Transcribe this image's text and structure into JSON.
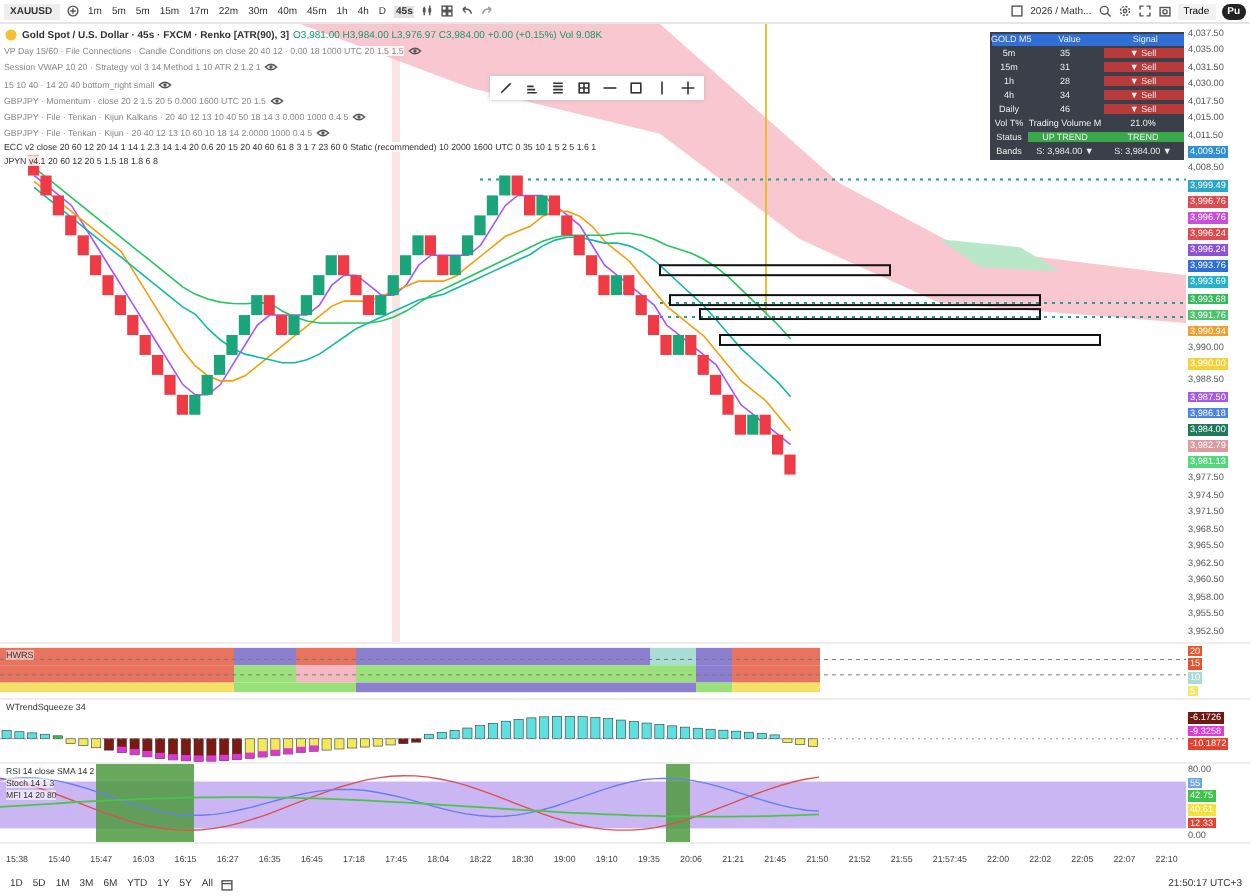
{
  "toolbar": {
    "symbol": "XAUUSD",
    "intervals": [
      {
        "label": "1m",
        "selected": false
      },
      {
        "label": "5m",
        "selected": false
      },
      {
        "label": "5m",
        "selected": false
      },
      {
        "label": "15m",
        "selected": false
      },
      {
        "label": "17m",
        "selected": false
      },
      {
        "label": "22m",
        "selected": false
      },
      {
        "label": "30m",
        "selected": false
      },
      {
        "label": "40m",
        "selected": false
      },
      {
        "label": "45m",
        "selected": false
      },
      {
        "label": "1h",
        "selected": false
      },
      {
        "label": "4h",
        "selected": false
      },
      {
        "label": "D",
        "selected": false
      },
      {
        "label": "45s",
        "selected": true
      }
    ],
    "layout_name": "2026 / Math...",
    "trade": "Trade",
    "publish": "Pu"
  },
  "legend": {
    "title": "Gold Spot / U.S. Dollar · 45s · FXCM · Renko [ATR(90), 3]",
    "ohlc": "O3,981.00 H3,984.00 L3,976.97 C3,984.00 +0.00 (+0.15%) Vol 9.08K",
    "indicators": [
      "VP Day 15/60 · File Connections · Candle Conditions on close 20 40 12 · 0.00 18 1000 UTC 20 1.5 1.5",
      "Session VWAP 10 20 · Strategy vol 3 14 Method 1 10 ATR 2 1.2 1",
      "15 10 40 · 14 20 40 bottom_right small",
      "GBPJPY · Momentum · close 20 2 1.5 20 5 0.000 1600 UTC 20 1.5",
      "GBPJPY · File · Tenkan · Kijun Kalkans · 20 40 12 13 10 40 50 18 14 3 0.000 1000 0.4 5",
      "GBPJPY · File · Tenkan · Kijun · 20 40 12 13 10 60 10 18 14 2.0000 1000 0.4 5"
    ],
    "extra": [
      "ECC v2 close 20 60 12 20 14 1 14 1 2.3 14 1.4 20 0.6 20 15 20 40 60 61 8 3 1 7 23 60 0 Static (recommended) 10 2000 1600 UTC 0 35 10 1 5 2 5 1.6 1",
      "JPYN v4.1 20 60 12 20 5 1.5 18 1.8 6 8"
    ]
  },
  "signal_table": {
    "rows": [
      {
        "kind": "header",
        "cells": [
          "GOLD M5",
          "Value",
          "Signal"
        ]
      },
      {
        "kind": "sell",
        "cells": [
          "5m",
          "35",
          "▼ Sell"
        ]
      },
      {
        "kind": "sell",
        "cells": [
          "15m",
          "31",
          "▼ Sell"
        ]
      },
      {
        "kind": "sell",
        "cells": [
          "1h",
          "28",
          "▼ Sell"
        ]
      },
      {
        "kind": "sell",
        "cells": [
          "4h",
          "34",
          "▼ Sell"
        ]
      },
      {
        "kind": "sell",
        "cells": [
          "Daily",
          "46",
          "▼ Sell"
        ]
      },
      {
        "kind": "plain",
        "cells": [
          "Vol T%",
          "Trading Volume M",
          "21.0%"
        ]
      },
      {
        "kind": "buy",
        "cells": [
          "Status",
          "UP TREND",
          "TREND"
        ]
      },
      {
        "kind": "plain",
        "cells": [
          "Bands",
          "S: 3,984.00 ▼",
          "S: 3,984.00 ▼"
        ]
      }
    ]
  },
  "price_axis": [
    {
      "text": "4,037.50"
    },
    {
      "text": "4,035.00"
    },
    {
      "text": "4,031.50"
    },
    {
      "text": "4,030.00"
    },
    {
      "text": "4,017.50"
    },
    {
      "text": "4,015.00"
    },
    {
      "text": "4,011.50"
    },
    {
      "text": "4,009.50",
      "color": "#2e8fd6"
    },
    {
      "text": "4,008.50"
    },
    {
      "text": "3,999.49",
      "color": "#2aa6c9"
    },
    {
      "text": "3,996.76",
      "color": "#e0494d"
    },
    {
      "text": "3,996.76",
      "color": "#c84fd8"
    },
    {
      "text": "3,996.24",
      "color": "#e0494d"
    },
    {
      "text": "3,996.24",
      "color": "#8e52d6"
    },
    {
      "text": "3,993.76",
      "color": "#2e6fd6"
    },
    {
      "text": "3,993.69",
      "color": "#26b3c9"
    },
    {
      "text": "3,993.68",
      "color": "#36b85c"
    },
    {
      "text": "3,991.76",
      "color": "#4cc46a"
    },
    {
      "text": "3,990.94",
      "color": "#f0a030"
    },
    {
      "text": "3,990.00"
    },
    {
      "text": "3,990.00",
      "color": "#f2d23a"
    },
    {
      "text": "3,988.50"
    },
    {
      "text": "3,987.50",
      "color": "#a65be0"
    },
    {
      "text": "3,986.18",
      "color": "#4a86e0"
    },
    {
      "text": "3,984.00",
      "color": "#1f7a5c"
    },
    {
      "text": "3,982.79",
      "color": "#d99aa0"
    },
    {
      "text": "3,981.13",
      "color": "#55d67a"
    },
    {
      "text": "3,977.50"
    },
    {
      "text": "3,974.50"
    },
    {
      "text": "3,971.50"
    },
    {
      "text": "3,968.50"
    },
    {
      "text": "3,965.50"
    },
    {
      "text": "3,962.50"
    },
    {
      "text": "3,960.50"
    },
    {
      "text": "3,958.00"
    },
    {
      "text": "3,955.50"
    },
    {
      "text": "3,952.50"
    }
  ],
  "hwrs": {
    "label": "HWRS",
    "tags": [
      {
        "text": "20",
        "color": "#e8542f"
      },
      {
        "text": "15",
        "color": "#e8542f"
      },
      {
        "text": "10",
        "color": "#a8dcd4"
      },
      {
        "text": "5",
        "color": "#f5e66a"
      }
    ]
  },
  "squeeze": {
    "label": "WTrendSqueeze 34",
    "tags": [
      {
        "text": "-6.1726",
        "color": "#6e1a10"
      },
      {
        "text": "-9.3258",
        "color": "#e03ad8"
      },
      {
        "text": "-10.1872",
        "color": "#e8402f"
      }
    ]
  },
  "rsi": {
    "labels": [
      "RSI 14 close SMA 14 2",
      "Stoch 14 1 3",
      "MFI 14 20 80"
    ],
    "tags": [
      {
        "text": "80.00"
      },
      {
        "text": "55",
        "color": "#6aa7e8"
      },
      {
        "text": "42.75",
        "color": "#3cc44c"
      },
      {
        "text": "40.61",
        "color": "#f2e23a"
      },
      {
        "text": "12.33",
        "color": "#e8402f"
      },
      {
        "text": "0.00"
      }
    ]
  },
  "time_axis": [
    "15:38",
    "15:40",
    "15:47",
    "16:03",
    "16:15",
    "16:27",
    "16:35",
    "16:45",
    "17:18",
    "17:45",
    "18:04",
    "18:22",
    "18:30",
    "19:00",
    "19:10",
    "19:35",
    "20:06",
    "21:21",
    "21:45",
    "21:50",
    "21:52",
    "21:55",
    "21:57:45",
    "22:00",
    "22:02",
    "22:05",
    "22:07",
    "22:10"
  ],
  "ranges": [
    "1D",
    "5D",
    "1M",
    "3M",
    "6M",
    "YTD",
    "1Y",
    "5Y",
    "All"
  ],
  "clock": "21:50:17 UTC+3"
}
